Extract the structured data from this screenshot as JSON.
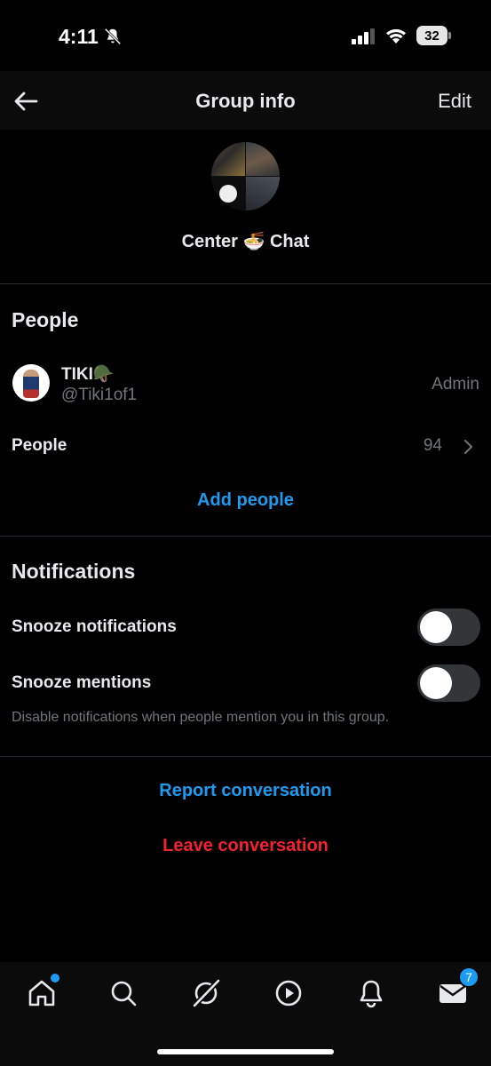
{
  "status_bar": {
    "time": "4:11",
    "battery": "32"
  },
  "header": {
    "title": "Group info",
    "edit_label": "Edit"
  },
  "group": {
    "name": "Center 🍜 Chat"
  },
  "people_section": {
    "title": "People",
    "members": [
      {
        "name": "TIKI🪖",
        "handle": "@Tiki1of1",
        "role": "Admin"
      }
    ],
    "people_row_label": "People",
    "people_count": "94",
    "add_people_label": "Add people"
  },
  "notifications_section": {
    "title": "Notifications",
    "snooze_notifications_label": "Snooze notifications",
    "snooze_notifications_on": false,
    "snooze_mentions_label": "Snooze mentions",
    "snooze_mentions_on": false,
    "mentions_hint": "Disable notifications when people mention you in this group."
  },
  "actions": {
    "report_label": "Report conversation",
    "leave_label": "Leave conversation"
  },
  "bottom_nav": {
    "items": [
      "home-icon",
      "search-icon",
      "grok-icon",
      "video-icon",
      "notifications-icon",
      "messages-icon"
    ],
    "messages_badge": "7"
  },
  "colors": {
    "accent": "#1d9bf0",
    "danger": "#f4212e",
    "muted": "#71767b"
  }
}
